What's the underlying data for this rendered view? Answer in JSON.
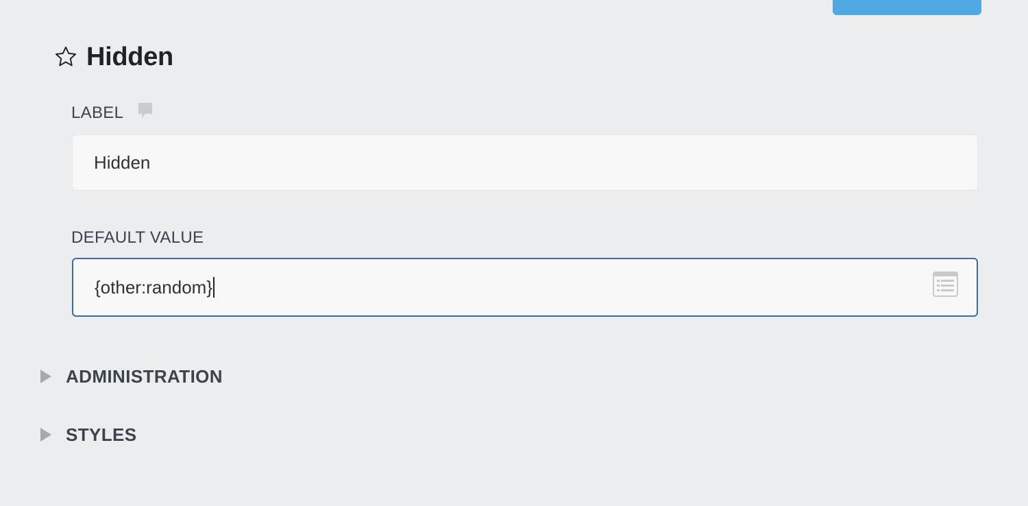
{
  "header": {
    "title": "Hidden",
    "icon": "star-outline-icon"
  },
  "fields": {
    "label": {
      "label": "LABEL",
      "tooltip_icon": "comment-icon",
      "value": "Hidden"
    },
    "default_value": {
      "label": "DEFAULT VALUE",
      "value": "{other:random}",
      "smart_tags_icon": "list-icon"
    }
  },
  "sections": [
    {
      "label": "ADMINISTRATION",
      "expanded": false,
      "icon": "triangle-right-icon"
    },
    {
      "label": "STYLES",
      "expanded": false,
      "icon": "triangle-right-icon"
    }
  ],
  "colors": {
    "background": "#ecedef",
    "accent_button": "#4ea8e2",
    "focus_border": "#3a6da2",
    "input_bg": "#f8f8f8"
  }
}
